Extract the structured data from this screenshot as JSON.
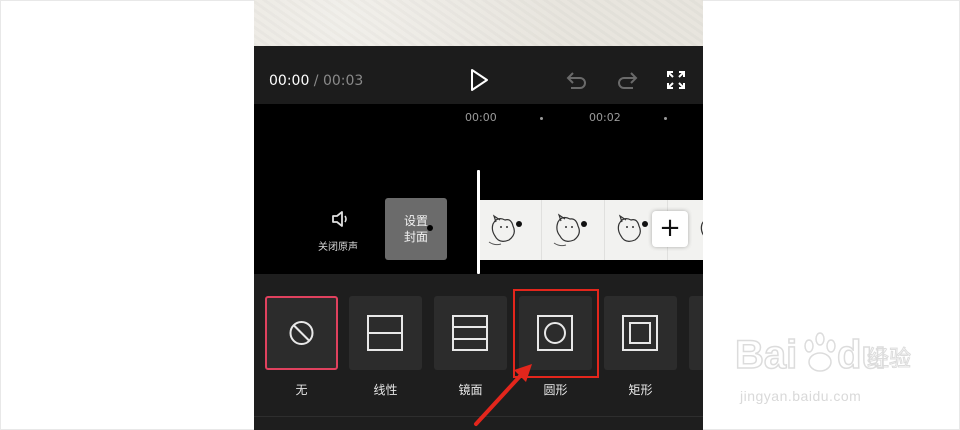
{
  "player": {
    "current_time": "00:00",
    "separator": " / ",
    "total_time": "00:03"
  },
  "icons": {
    "play": "play-icon",
    "undo": "undo-icon",
    "redo": "redo-icon",
    "fullscreen": "fullscreen-icon",
    "mute": "speaker-icon",
    "add": "plus-icon"
  },
  "ruler": {
    "marks": [
      "00:00",
      "00:02"
    ]
  },
  "track": {
    "mute_label": "关闭原声",
    "cover_line1": "设置",
    "cover_line2": "封面",
    "add_label": "+"
  },
  "masks": {
    "items": [
      {
        "label": "无",
        "icon": "none-icon",
        "selected": true
      },
      {
        "label": "线性",
        "icon": "linear-mask-icon"
      },
      {
        "label": "镜面",
        "icon": "mirror-mask-icon"
      },
      {
        "label": "圆形",
        "icon": "circle-mask-icon",
        "highlighted": true
      },
      {
        "label": "矩形",
        "icon": "rectangle-mask-icon"
      }
    ]
  },
  "watermark": {
    "brand": "Bai du 经验",
    "url": "jingyan.baidu.com"
  },
  "colors": {
    "selected_border": "#e0415e",
    "highlight_annotation": "#e3261c",
    "background": "#151515"
  }
}
